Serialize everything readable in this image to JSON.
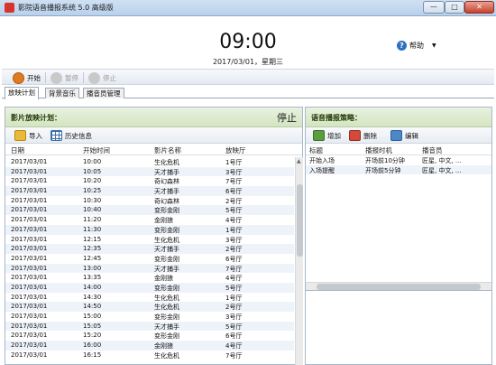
{
  "window": {
    "title": "影院语音播报系统 5.0 高级版",
    "min": "—",
    "max": "□",
    "close": "✕"
  },
  "header": {
    "time": "09:00",
    "date": "2017/03/01，星期三",
    "help": "帮助",
    "help_icon": "?",
    "help_caret": "▼"
  },
  "toolbar": {
    "start": "开始",
    "pause": "暂停",
    "stop": "停止"
  },
  "tabs": [
    "放映计划",
    "背景音乐",
    "播音员管理"
  ],
  "left_panel": {
    "title": "影片放映计划：",
    "status": "停止",
    "import": "导入",
    "history": "历史信息",
    "columns": [
      "日期",
      "开始时间",
      "影片名称",
      "放映厅"
    ],
    "rows": [
      [
        "2017/03/01",
        "10:00",
        "生化危机",
        "1号厅"
      ],
      [
        "2017/03/01",
        "10:05",
        "天才捕手",
        "3号厅"
      ],
      [
        "2017/03/01",
        "10:20",
        "奇幻森林",
        "7号厅"
      ],
      [
        "2017/03/01",
        "10:25",
        "天才捕手",
        "6号厅"
      ],
      [
        "2017/03/01",
        "10:30",
        "奇幻森林",
        "2号厅"
      ],
      [
        "2017/03/01",
        "10:40",
        "变形金刚",
        "5号厅"
      ],
      [
        "2017/03/01",
        "11:20",
        "金刚狼",
        "4号厅"
      ],
      [
        "2017/03/01",
        "11:30",
        "变形金刚",
        "1号厅"
      ],
      [
        "2017/03/01",
        "12:15",
        "生化危机",
        "3号厅"
      ],
      [
        "2017/03/01",
        "12:35",
        "天才捕手",
        "2号厅"
      ],
      [
        "2017/03/01",
        "12:45",
        "变形金刚",
        "6号厅"
      ],
      [
        "2017/03/01",
        "13:00",
        "天才捕手",
        "7号厅"
      ],
      [
        "2017/03/01",
        "13:35",
        "金刚狼",
        "4号厅"
      ],
      [
        "2017/03/01",
        "14:00",
        "变形金刚",
        "5号厅"
      ],
      [
        "2017/03/01",
        "14:30",
        "生化危机",
        "1号厅"
      ],
      [
        "2017/03/01",
        "14:50",
        "生化危机",
        "2号厅"
      ],
      [
        "2017/03/01",
        "15:00",
        "变形金刚",
        "3号厅"
      ],
      [
        "2017/03/01",
        "15:05",
        "天才捕手",
        "5号厅"
      ],
      [
        "2017/03/01",
        "15:20",
        "变形金刚",
        "6号厅"
      ],
      [
        "2017/03/01",
        "16:00",
        "金刚狼",
        "4号厅"
      ],
      [
        "2017/03/01",
        "16:15",
        "生化危机",
        "7号厅"
      ]
    ]
  },
  "right_panel": {
    "title": "语音播报策略：",
    "add": "增加",
    "delete": "删除",
    "edit": "编辑",
    "columns": [
      "标题",
      "播报时机",
      "播音员"
    ],
    "rows": [
      [
        "开始入场",
        "开场前10分钟",
        "匠星, 中文, ..."
      ],
      [
        "入场提醒",
        "开场前5分钟",
        "匠星, 中文, ..."
      ]
    ]
  },
  "colors": {
    "panel_header": "#d4e5c1",
    "accent": "#2f6fc1",
    "start_icon": "#e07a1f"
  }
}
